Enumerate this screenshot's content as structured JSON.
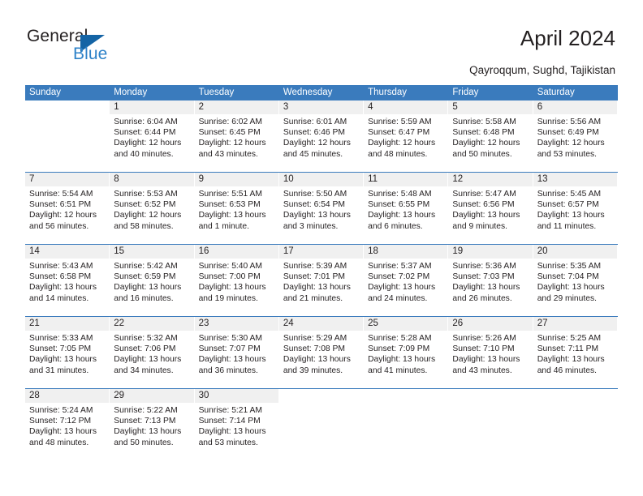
{
  "brand": {
    "name_top": "General",
    "name_bottom": "Blue",
    "triangle_color": "#1464a5",
    "blue_text_color": "#2e82c8"
  },
  "header": {
    "title": "April 2024",
    "subtitle": "Qayroqqum, Sughd, Tajikistan",
    "accent_color": "#3a7bbd",
    "band_color": "#f0f0f0"
  },
  "calendar": {
    "weekday_headers": [
      "Sunday",
      "Monday",
      "Tuesday",
      "Wednesday",
      "Thursday",
      "Friday",
      "Saturday"
    ],
    "weeks": [
      [
        {
          "day": "",
          "sunrise": "",
          "sunset": "",
          "daylight1": "",
          "daylight2": ""
        },
        {
          "day": "1",
          "sunrise": "Sunrise: 6:04 AM",
          "sunset": "Sunset: 6:44 PM",
          "daylight1": "Daylight: 12 hours",
          "daylight2": "and 40 minutes."
        },
        {
          "day": "2",
          "sunrise": "Sunrise: 6:02 AM",
          "sunset": "Sunset: 6:45 PM",
          "daylight1": "Daylight: 12 hours",
          "daylight2": "and 43 minutes."
        },
        {
          "day": "3",
          "sunrise": "Sunrise: 6:01 AM",
          "sunset": "Sunset: 6:46 PM",
          "daylight1": "Daylight: 12 hours",
          "daylight2": "and 45 minutes."
        },
        {
          "day": "4",
          "sunrise": "Sunrise: 5:59 AM",
          "sunset": "Sunset: 6:47 PM",
          "daylight1": "Daylight: 12 hours",
          "daylight2": "and 48 minutes."
        },
        {
          "day": "5",
          "sunrise": "Sunrise: 5:58 AM",
          "sunset": "Sunset: 6:48 PM",
          "daylight1": "Daylight: 12 hours",
          "daylight2": "and 50 minutes."
        },
        {
          "day": "6",
          "sunrise": "Sunrise: 5:56 AM",
          "sunset": "Sunset: 6:49 PM",
          "daylight1": "Daylight: 12 hours",
          "daylight2": "and 53 minutes."
        }
      ],
      [
        {
          "day": "7",
          "sunrise": "Sunrise: 5:54 AM",
          "sunset": "Sunset: 6:51 PM",
          "daylight1": "Daylight: 12 hours",
          "daylight2": "and 56 minutes."
        },
        {
          "day": "8",
          "sunrise": "Sunrise: 5:53 AM",
          "sunset": "Sunset: 6:52 PM",
          "daylight1": "Daylight: 12 hours",
          "daylight2": "and 58 minutes."
        },
        {
          "day": "9",
          "sunrise": "Sunrise: 5:51 AM",
          "sunset": "Sunset: 6:53 PM",
          "daylight1": "Daylight: 13 hours",
          "daylight2": "and 1 minute."
        },
        {
          "day": "10",
          "sunrise": "Sunrise: 5:50 AM",
          "sunset": "Sunset: 6:54 PM",
          "daylight1": "Daylight: 13 hours",
          "daylight2": "and 3 minutes."
        },
        {
          "day": "11",
          "sunrise": "Sunrise: 5:48 AM",
          "sunset": "Sunset: 6:55 PM",
          "daylight1": "Daylight: 13 hours",
          "daylight2": "and 6 minutes."
        },
        {
          "day": "12",
          "sunrise": "Sunrise: 5:47 AM",
          "sunset": "Sunset: 6:56 PM",
          "daylight1": "Daylight: 13 hours",
          "daylight2": "and 9 minutes."
        },
        {
          "day": "13",
          "sunrise": "Sunrise: 5:45 AM",
          "sunset": "Sunset: 6:57 PM",
          "daylight1": "Daylight: 13 hours",
          "daylight2": "and 11 minutes."
        }
      ],
      [
        {
          "day": "14",
          "sunrise": "Sunrise: 5:43 AM",
          "sunset": "Sunset: 6:58 PM",
          "daylight1": "Daylight: 13 hours",
          "daylight2": "and 14 minutes."
        },
        {
          "day": "15",
          "sunrise": "Sunrise: 5:42 AM",
          "sunset": "Sunset: 6:59 PM",
          "daylight1": "Daylight: 13 hours",
          "daylight2": "and 16 minutes."
        },
        {
          "day": "16",
          "sunrise": "Sunrise: 5:40 AM",
          "sunset": "Sunset: 7:00 PM",
          "daylight1": "Daylight: 13 hours",
          "daylight2": "and 19 minutes."
        },
        {
          "day": "17",
          "sunrise": "Sunrise: 5:39 AM",
          "sunset": "Sunset: 7:01 PM",
          "daylight1": "Daylight: 13 hours",
          "daylight2": "and 21 minutes."
        },
        {
          "day": "18",
          "sunrise": "Sunrise: 5:37 AM",
          "sunset": "Sunset: 7:02 PM",
          "daylight1": "Daylight: 13 hours",
          "daylight2": "and 24 minutes."
        },
        {
          "day": "19",
          "sunrise": "Sunrise: 5:36 AM",
          "sunset": "Sunset: 7:03 PM",
          "daylight1": "Daylight: 13 hours",
          "daylight2": "and 26 minutes."
        },
        {
          "day": "20",
          "sunrise": "Sunrise: 5:35 AM",
          "sunset": "Sunset: 7:04 PM",
          "daylight1": "Daylight: 13 hours",
          "daylight2": "and 29 minutes."
        }
      ],
      [
        {
          "day": "21",
          "sunrise": "Sunrise: 5:33 AM",
          "sunset": "Sunset: 7:05 PM",
          "daylight1": "Daylight: 13 hours",
          "daylight2": "and 31 minutes."
        },
        {
          "day": "22",
          "sunrise": "Sunrise: 5:32 AM",
          "sunset": "Sunset: 7:06 PM",
          "daylight1": "Daylight: 13 hours",
          "daylight2": "and 34 minutes."
        },
        {
          "day": "23",
          "sunrise": "Sunrise: 5:30 AM",
          "sunset": "Sunset: 7:07 PM",
          "daylight1": "Daylight: 13 hours",
          "daylight2": "and 36 minutes."
        },
        {
          "day": "24",
          "sunrise": "Sunrise: 5:29 AM",
          "sunset": "Sunset: 7:08 PM",
          "daylight1": "Daylight: 13 hours",
          "daylight2": "and 39 minutes."
        },
        {
          "day": "25",
          "sunrise": "Sunrise: 5:28 AM",
          "sunset": "Sunset: 7:09 PM",
          "daylight1": "Daylight: 13 hours",
          "daylight2": "and 41 minutes."
        },
        {
          "day": "26",
          "sunrise": "Sunrise: 5:26 AM",
          "sunset": "Sunset: 7:10 PM",
          "daylight1": "Daylight: 13 hours",
          "daylight2": "and 43 minutes."
        },
        {
          "day": "27",
          "sunrise": "Sunrise: 5:25 AM",
          "sunset": "Sunset: 7:11 PM",
          "daylight1": "Daylight: 13 hours",
          "daylight2": "and 46 minutes."
        }
      ],
      [
        {
          "day": "28",
          "sunrise": "Sunrise: 5:24 AM",
          "sunset": "Sunset: 7:12 PM",
          "daylight1": "Daylight: 13 hours",
          "daylight2": "and 48 minutes."
        },
        {
          "day": "29",
          "sunrise": "Sunrise: 5:22 AM",
          "sunset": "Sunset: 7:13 PM",
          "daylight1": "Daylight: 13 hours",
          "daylight2": "and 50 minutes."
        },
        {
          "day": "30",
          "sunrise": "Sunrise: 5:21 AM",
          "sunset": "Sunset: 7:14 PM",
          "daylight1": "Daylight: 13 hours",
          "daylight2": "and 53 minutes."
        },
        {
          "day": "",
          "sunrise": "",
          "sunset": "",
          "daylight1": "",
          "daylight2": ""
        },
        {
          "day": "",
          "sunrise": "",
          "sunset": "",
          "daylight1": "",
          "daylight2": ""
        },
        {
          "day": "",
          "sunrise": "",
          "sunset": "",
          "daylight1": "",
          "daylight2": ""
        },
        {
          "day": "",
          "sunrise": "",
          "sunset": "",
          "daylight1": "",
          "daylight2": ""
        }
      ]
    ]
  }
}
